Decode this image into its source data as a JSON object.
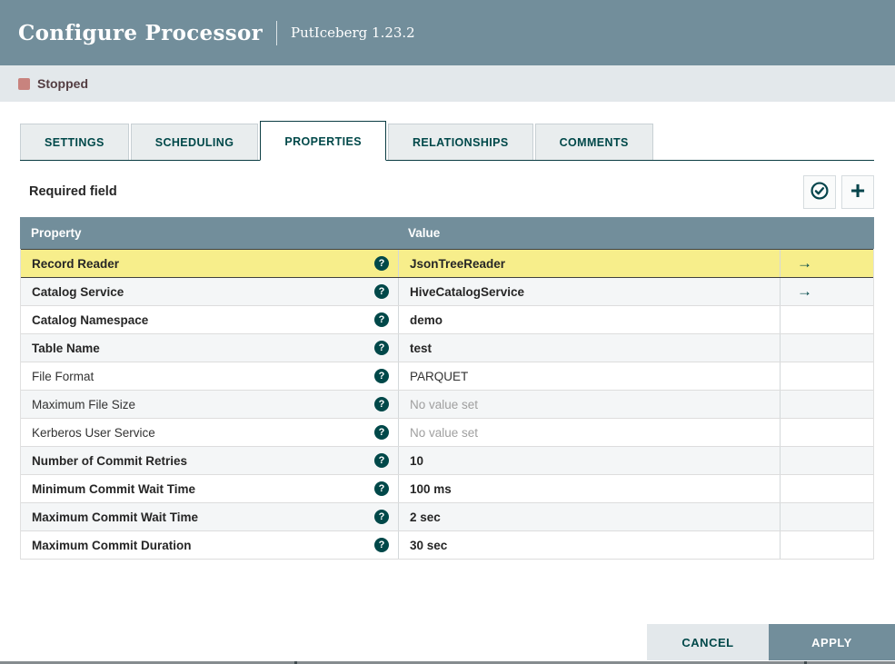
{
  "header": {
    "title": "Configure Processor",
    "subtitle": "PutIceberg 1.23.2"
  },
  "status": {
    "label": "Stopped",
    "color": "#c8837e"
  },
  "tabs": [
    {
      "label": "SETTINGS",
      "active": false
    },
    {
      "label": "SCHEDULING",
      "active": false
    },
    {
      "label": "PROPERTIES",
      "active": true
    },
    {
      "label": "RELATIONSHIPS",
      "active": false
    },
    {
      "label": "COMMENTS",
      "active": false
    }
  ],
  "toolbar": {
    "required_label": "Required field",
    "verify_icon": "check-circle-icon",
    "add_icon": "plus-icon"
  },
  "table": {
    "columns": [
      "Property",
      "Value"
    ],
    "rows": [
      {
        "property": "Record Reader",
        "value": "JsonTreeReader",
        "required": true,
        "selected": true,
        "goto": true,
        "value_state": "set"
      },
      {
        "property": "Catalog Service",
        "value": "HiveCatalogService",
        "required": true,
        "selected": false,
        "goto": true,
        "value_state": "set"
      },
      {
        "property": "Catalog Namespace",
        "value": "demo",
        "required": true,
        "selected": false,
        "goto": false,
        "value_state": "set"
      },
      {
        "property": "Table Name",
        "value": "test",
        "required": true,
        "selected": false,
        "goto": false,
        "value_state": "set"
      },
      {
        "property": "File Format",
        "value": "PARQUET",
        "required": false,
        "selected": false,
        "goto": false,
        "value_state": "set"
      },
      {
        "property": "Maximum File Size",
        "value": "No value set",
        "required": false,
        "selected": false,
        "goto": false,
        "value_state": "unset"
      },
      {
        "property": "Kerberos User Service",
        "value": "No value set",
        "required": false,
        "selected": false,
        "goto": false,
        "value_state": "unset"
      },
      {
        "property": "Number of Commit Retries",
        "value": "10",
        "required": true,
        "selected": false,
        "goto": false,
        "value_state": "set"
      },
      {
        "property": "Minimum Commit Wait Time",
        "value": "100 ms",
        "required": true,
        "selected": false,
        "goto": false,
        "value_state": "set"
      },
      {
        "property": "Maximum Commit Wait Time",
        "value": "2 sec",
        "required": true,
        "selected": false,
        "goto": false,
        "value_state": "set"
      },
      {
        "property": "Maximum Commit Duration",
        "value": "30 sec",
        "required": true,
        "selected": false,
        "goto": false,
        "value_state": "set"
      }
    ],
    "help_glyph": "?",
    "goto_glyph": "→"
  },
  "footer": {
    "cancel_label": "CANCEL",
    "apply_label": "APPLY"
  },
  "colors": {
    "header_bg": "#728e9b",
    "status_bar_bg": "#e3e8eb",
    "stopped_icon": "#c8837e",
    "accent_teal": "#004849",
    "selected_row_bg": "#f7ee8b",
    "alt_row_bg": "#f4f6f7",
    "table_header_bg": "#728e9b"
  }
}
